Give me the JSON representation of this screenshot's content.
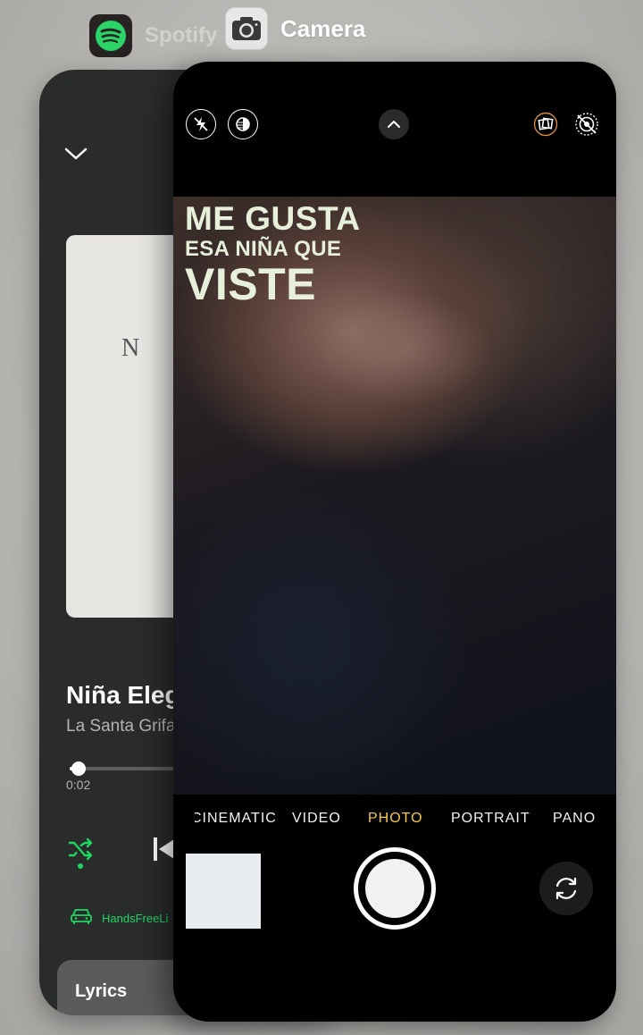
{
  "switcher": {
    "apps": [
      {
        "name": "Spotify",
        "icon": "spotify-icon"
      },
      {
        "name": "Camera",
        "icon": "camera-icon"
      }
    ]
  },
  "spotify": {
    "accent": "#1ed760",
    "album_art_text": "N",
    "track_title": "Niña Eleg",
    "artist": "La Santa Grifa",
    "elapsed": "0:02",
    "device": "HandsFreeLi",
    "lyrics_label": "Lyrics",
    "icons": [
      "chevron-down-icon",
      "shuffle-icon",
      "previous-track-icon",
      "car-icon"
    ]
  },
  "camera": {
    "caption": {
      "line1": "ME GUSTA",
      "line2": "ESA NIÑA QUE",
      "line3": "VISTE"
    },
    "modes": [
      {
        "label": "CINEMATIC",
        "active": false
      },
      {
        "label": "VIDEO",
        "active": false
      },
      {
        "label": "PHOTO",
        "active": true
      },
      {
        "label": "PORTRAIT",
        "active": false
      },
      {
        "label": "PANO",
        "active": false
      }
    ],
    "active_mode_color": "#f7c948",
    "icons": [
      "flash-off-icon",
      "night-mode-icon",
      "chevron-up-icon",
      "live-photo-icon",
      "live-off-icon",
      "flip-camera-icon"
    ]
  }
}
